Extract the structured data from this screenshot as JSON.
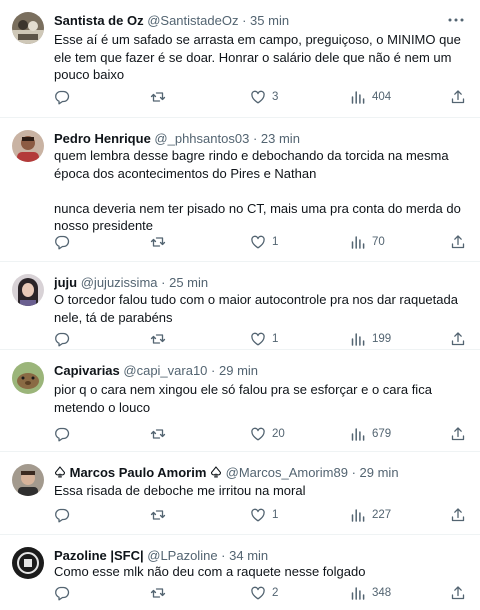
{
  "colors": {
    "text": "#0f1419",
    "secondary": "#536471",
    "divider": "#eff3f4"
  },
  "tweets": [
    {
      "name": "Santista de Oz",
      "handle": "@SantistadeOz",
      "dot": "·",
      "time": "35 min",
      "text": "Esse aí é um safado se arrasta em campo, preguiçoso, o MINIMO que ele tem que fazer é se doar. Honrar o salário dele que não é nem um pouco baixo",
      "replies": "",
      "retweets": "",
      "likes": "3",
      "views": "404",
      "avatar": "avatar-photo"
    },
    {
      "name": "Pedro Henrique",
      "handle": "@_phhsantos03",
      "dot": "·",
      "time": "23 min",
      "text": "quem lembra desse bagre rindo e debochando da torcida na mesma época dos acontecimentos do Pires e Nathan\n\nnunca deveria nem ter pisado no CT, mais uma pra conta do merda do nosso presidente",
      "replies": "",
      "retweets": "",
      "likes": "1",
      "views": "70",
      "avatar": "avatar-photo"
    },
    {
      "name": "juju",
      "handle": "@jujuzissima",
      "dot": "·",
      "time": "25 min",
      "text": "O torcedor falou tudo com o maior autocontrole pra nos dar raquetada nele, tá de parabéns",
      "replies": "",
      "retweets": "",
      "likes": "1",
      "views": "199",
      "avatar": "avatar-photo"
    },
    {
      "name": "Capivarias",
      "handle": "@capi_vara10",
      "dot": "·",
      "time": "29 min",
      "text": "pior q o cara nem xingou ele só falou pra se esforçar e o cara fica metendo o louco",
      "replies": "",
      "retweets": "",
      "likes": "20",
      "views": "679",
      "avatar": "avatar-photo"
    },
    {
      "name": "Marcos Paulo Amorim",
      "handle": "@Marcos_Amorim89",
      "dot": "·",
      "time": "29 min",
      "text": "Essa risada de deboche me irritou na moral",
      "replies": "",
      "retweets": "",
      "likes": "1",
      "views": "227",
      "avatar": "avatar-photo"
    },
    {
      "name": "Pazoline |SFC|",
      "handle": "@LPazoline",
      "dot": "·",
      "time": "34 min",
      "text": "Como esse mlk não deu com a raquete nesse folgado",
      "replies": "",
      "retweets": "",
      "likes": "2",
      "views": "348",
      "avatar": "avatar-photo"
    }
  ]
}
